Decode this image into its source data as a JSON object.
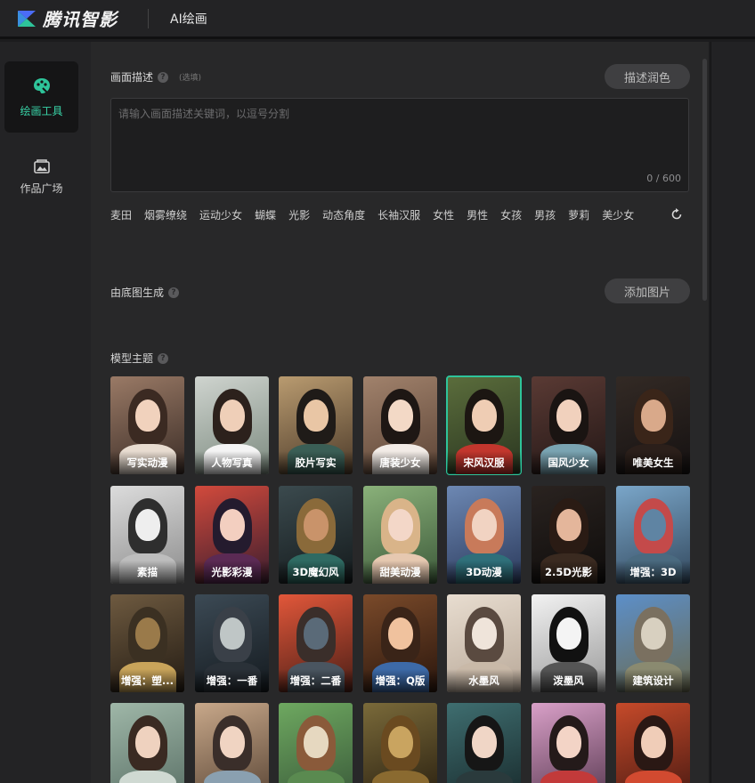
{
  "header": {
    "brand": "腾讯智影",
    "title": "AI绘画",
    "accent": "#2ec49a"
  },
  "sidebar": {
    "items": [
      {
        "label": "绘画工具",
        "icon": "palette-icon",
        "active": true
      },
      {
        "label": "作品广场",
        "icon": "gallery-icon",
        "active": false
      }
    ]
  },
  "description": {
    "label": "画面描述",
    "optional": "(选填)",
    "polish_button": "描述润色",
    "placeholder": "请输入画面描述关键词，以逗号分割",
    "value": "",
    "counter": "0 / 600"
  },
  "tags": [
    "麦田",
    "烟雾缭绕",
    "运动少女",
    "蝴蝶",
    "光影",
    "动态角度",
    "长袖汉服",
    "女性",
    "男性",
    "女孩",
    "男孩",
    "萝莉",
    "美少女"
  ],
  "base_image": {
    "label": "由底图生成",
    "add_button": "添加图片"
  },
  "models": {
    "label": "模型主题",
    "selected": "宋风汉服",
    "cards": [
      {
        "label": "写实动漫",
        "bg": [
          "#9a7a66",
          "#3a2c26"
        ],
        "skin": "#f1d2bd",
        "hair": "#3b2a22",
        "cloth": "#e8dcd0"
      },
      {
        "label": "人物写真",
        "bg": [
          "#cfd4cf",
          "#7c8a7f"
        ],
        "skin": "#efcfb8",
        "hair": "#2c211c",
        "cloth": "#f4f4f4"
      },
      {
        "label": "胶片写实",
        "bg": [
          "#b99b70",
          "#4d3b2a"
        ],
        "skin": "#e9c6a5",
        "hair": "#1f1b18",
        "cloth": "#3a5e55"
      },
      {
        "label": "唐装少女",
        "bg": [
          "#a1826c",
          "#5c4436"
        ],
        "skin": "#f3d9c6",
        "hair": "#1e1714",
        "cloth": "#f2ebe6"
      },
      {
        "label": "宋风汉服",
        "bg": [
          "#5b6d3c",
          "#2a3620"
        ],
        "skin": "#efcdb4",
        "hair": "#1c1612",
        "cloth": "#c2362d"
      },
      {
        "label": "国风少女",
        "bg": [
          "#5a3a34",
          "#231716"
        ],
        "skin": "#f1d1bd",
        "hair": "#1a1412",
        "cloth": "#7aa4b2"
      },
      {
        "label": "唯美女生",
        "bg": [
          "#332a25",
          "#151111"
        ],
        "skin": "#d9a98a",
        "hair": "#3a2519",
        "cloth": "#2b1f1a"
      },
      {
        "label": "素描",
        "bg": [
          "#dcdcdc",
          "#8c8c8c"
        ],
        "skin": "#eeeeee",
        "hair": "#2e2e2e",
        "cloth": "#bdbdbd"
      },
      {
        "label": "光影彩漫",
        "bg": [
          "#d24a3c",
          "#3a1d2e"
        ],
        "skin": "#f3cfc0",
        "hair": "#241b2e",
        "cloth": "#5b2a54"
      },
      {
        "label": "3D魔幻风",
        "bg": [
          "#3b4a4e",
          "#141a1c"
        ],
        "skin": "#c9936a",
        "hair": "#8a6a3a",
        "cloth": "#2f6a62"
      },
      {
        "label": "甜美动漫",
        "bg": [
          "#8ab17a",
          "#3d5a3a"
        ],
        "skin": "#f3d7c8",
        "hair": "#d9b489",
        "cloth": "#e6c8b0"
      },
      {
        "label": "3D动漫",
        "bg": [
          "#6d88b3",
          "#2b3a5c"
        ],
        "skin": "#f1d3c2",
        "hair": "#c87a5a",
        "cloth": "#2f6f7a"
      },
      {
        "label": "2.5D光影",
        "bg": [
          "#2a2320",
          "#0e0c0b"
        ],
        "skin": "#e4b69b",
        "hair": "#2a1b14",
        "cloth": "#3a2a20"
      },
      {
        "label": "增强：3D",
        "bg": [
          "#7aa6c9",
          "#33495e"
        ],
        "skin": "#5f84a3",
        "hair": "#c44a4a",
        "cloth": "#4a6a80"
      },
      {
        "label": "增强：塑...",
        "bg": [
          "#6e5a40",
          "#231b13"
        ],
        "skin": "#9a7a4a",
        "hair": "#3b3022",
        "cloth": "#c9a45a"
      },
      {
        "label": "增强：一番",
        "bg": [
          "#3c4a55",
          "#141a1f"
        ],
        "skin": "#bfc6c6",
        "hair": "#3a4048",
        "cloth": "#2a3138"
      },
      {
        "label": "增强：二番",
        "bg": [
          "#e2573a",
          "#4a1e16"
        ],
        "skin": "#5a6a78",
        "hair": "#3a2e2a",
        "cloth": "#4a5560"
      },
      {
        "label": "增强：Q版",
        "bg": [
          "#7a4a2a",
          "#2a160d"
        ],
        "skin": "#f0c29e",
        "hair": "#3a2418",
        "cloth": "#3d6aa8"
      },
      {
        "label": "水墨风",
        "bg": [
          "#e8ddd0",
          "#b8a898"
        ],
        "skin": "#efe4da",
        "hair": "#5a4a40",
        "cloth": "#c9b9a8"
      },
      {
        "label": "泼墨风",
        "bg": [
          "#f2f2f2",
          "#9a9a9a"
        ],
        "skin": "#f4f4f4",
        "hair": "#111111",
        "cloth": "#555555"
      },
      {
        "label": "建筑设计",
        "bg": [
          "#5c8fc9",
          "#6a6a50"
        ],
        "skin": "#d8d0c0",
        "hair": "#7a7060",
        "cloth": "#8a8a70"
      },
      {
        "label": "",
        "bg": [
          "#9fb7a8",
          "#5a7066"
        ],
        "skin": "#efd2bf",
        "hair": "#3a2a22",
        "cloth": "#cfd9d2"
      },
      {
        "label": "",
        "bg": [
          "#c8a88a",
          "#5a4636"
        ],
        "skin": "#f0d4c2",
        "hair": "#3a2e2a",
        "cloth": "#8aa0b0"
      },
      {
        "label": "",
        "bg": [
          "#6ea860",
          "#3a5a3a"
        ],
        "skin": "#e6d8c0",
        "hair": "#8a5a3a",
        "cloth": "#5a8a50"
      },
      {
        "label": "",
        "bg": [
          "#7a6a3a",
          "#2a2010"
        ],
        "skin": "#c9a460",
        "hair": "#6a4a20",
        "cloth": "#8a6a30"
      },
      {
        "label": "",
        "bg": [
          "#3f6e70",
          "#182a2c"
        ],
        "skin": "#f0d6c6",
        "hair": "#161616",
        "cloth": "#2a3a3c"
      },
      {
        "label": "",
        "bg": [
          "#d9a0c8",
          "#5a3a52"
        ],
        "skin": "#f3d4c6",
        "hair": "#241a1a",
        "cloth": "#c23a3a"
      },
      {
        "label": "",
        "bg": [
          "#c64a2a",
          "#4a1a12"
        ],
        "skin": "#f0cdb8",
        "hair": "#2a1814",
        "cloth": "#d24a30"
      }
    ]
  }
}
